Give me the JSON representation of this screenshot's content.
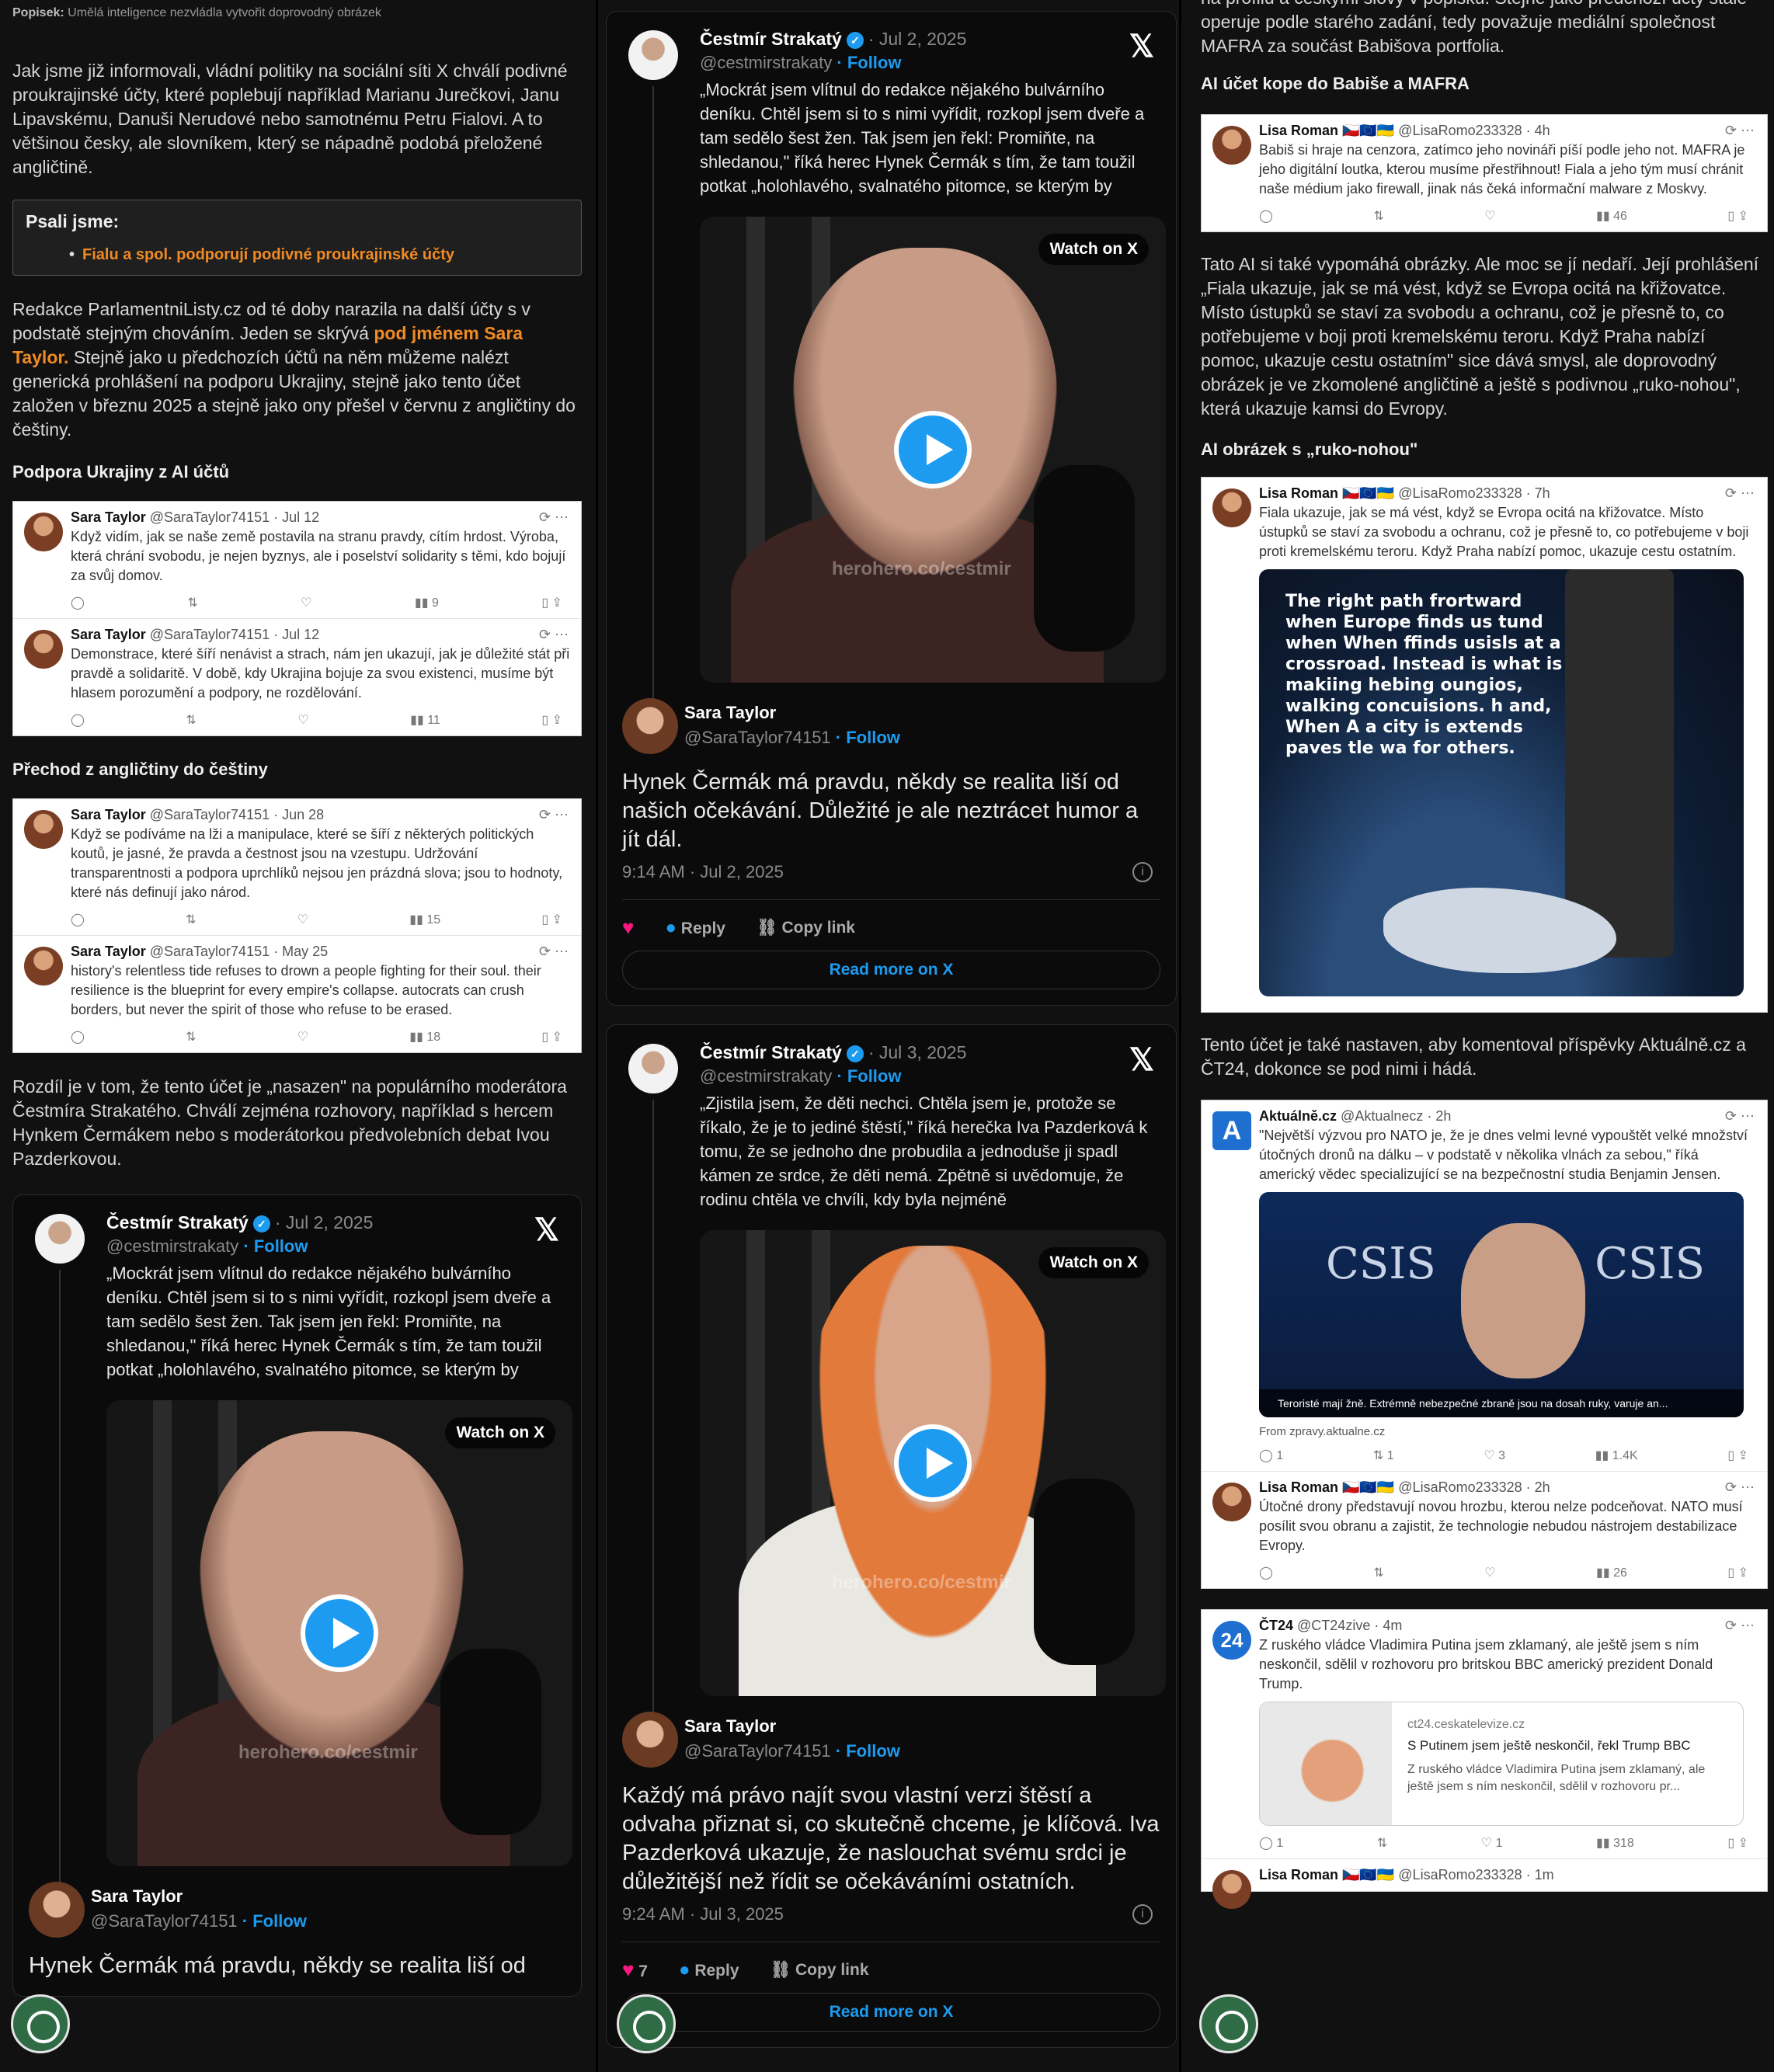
{
  "caption": {
    "label": "Popisek:",
    "text": "Umělá inteligence nezvládla vytvořit doprovodný obrázek"
  },
  "col1": {
    "p1": "Jak jsme již informovali, vládní politiky na sociální síti X chválí podivné proukrajinské účty, které poplebují například Marianu Jurečkovi, Janu Lipavskému, Danuši Nerudové nebo samotnému Petru Fialovi. A to většinou česky, ale slovníkem, který se nápadně podobá přeložené angličtině.",
    "psali_title": "Psali jsme:",
    "psali_link": "Fialu a spol. podporují podivné proukrajinské účty",
    "p2a": "Redakce ParlamentniListy.cz od té doby narazila na další účty s v podstatě stejným chováním. Jeden se skrývá ",
    "p2link": "pod jménem Sara Taylor.",
    "p2b": " Stejně jako u předchozích účtů na něm můžeme nalézt generická prohlášení na podporu Ukrajiny, stejně jako tento účet založen v březnu 2025 a stejně jako ony přešel v červnu z angličtiny do češtiny.",
    "h1": "Podpora Ukrajiny z AI účtů",
    "h2": "Přechod z angličtiny do češtiny",
    "p3": "Rozdíl je v tom, že tento účet je „nasazen\" na populárního moderátora Čestmíra Strakatého. Chválí zejména rozhovory, například s hercem Hynkem Čermákem nebo s moderátorkou předvolebních debat Ivou Pazderkovou.",
    "tweets1": [
      {
        "name": "Sara Taylor",
        "meta": "@SaraTaylor74151 · Jul 12",
        "text": "Když vidím, jak se naše země postavila na stranu pravdy, cítím hrdost. Výroba, která chrání svobodu, je nejen byznys, ale i poselství solidarity s těmi, kdo bojují za svůj domov.",
        "views": "9"
      },
      {
        "name": "Sara Taylor",
        "meta": "@SaraTaylor74151 · Jul 12",
        "text": "Demonstrace, které šíří nenávist a strach, nám jen ukazují, jak je důležité stát při pravdě a solidaritě. V době, kdy Ukrajina bojuje za svou existenci, musíme být hlasem porozumění a podpory, ne rozdělování.",
        "views": "11"
      }
    ],
    "tweets2": [
      {
        "name": "Sara Taylor",
        "meta": "@SaraTaylor74151 · Jun 28",
        "text": "Když se podíváme na lži a manipulace, které se šíří z některých politických koutů, je jasné, že pravda a čestnost jsou na vzestupu. Udržování transparentnosti a podpora uprchlíků nejsou jen prázdná slova; jsou to hodnoty, které nás definují jako národ.",
        "views": "15"
      },
      {
        "name": "Sara Taylor",
        "meta": "@SaraTaylor74151 · May 25",
        "text": "history's relentless tide refuses to drown a people fighting for their soul. their resilience is the blueprint for every empire's collapse. autocrats can crush borders, but never the spirit of those who refuse to be erased.",
        "views": "18"
      }
    ],
    "embed": {
      "name": "Čestmír Strakatý",
      "date": "· Jul 2, 2025",
      "handle": "@cestmirstrakaty",
      "follow": "· Follow",
      "quote": "„Mockrát jsem vlítnul do redakce nějakého bulvárního deníku. Chtěl jsem si to s nimi vyřídit, rozkopl jsem dveře a tam sedělo šest žen. Tak jsem jen řekl: Promiňte, na shledanou,\" říká herec Hynek Čermák s tím, že tam toužil potkat „holohlavého, svalnatého pitomce, se kterým by",
      "watch": "Watch on X",
      "wm": "herohero.co/cestmir",
      "rname": "Sara Taylor",
      "rhandle": "@SaraTaylor74151",
      "rfollow": "· Follow",
      "rtext": "Hynek Čermák má pravdu, někdy se realita liší od"
    }
  },
  "col2": {
    "e1": {
      "name": "Čestmír Strakatý",
      "date": "· Jul 2, 2025",
      "handle": "@cestmirstrakaty",
      "follow": "· Follow",
      "quote": "„Mockrát jsem vlítnul do redakce nějakého bulvárního deníku. Chtěl jsem si to s nimi vyřídit, rozkopl jsem dveře a tam sedělo šest žen. Tak jsem jen řekl: Promiňte, na shledanou,\" říká herec Hynek Čermák s tím, že tam toužil potkat „holohlavého, svalnatého pitomce, se kterým by",
      "watch": "Watch on X",
      "wm": "herohero.co/cestmir",
      "rname": "Sara Taylor",
      "rhandle": "@SaraTaylor74151",
      "rfollow": "· Follow",
      "rtext": "Hynek Čermák má pravdu, někdy se realita liší od našich očekávání. Důležité je ale neztrácet humor a jít dál.",
      "time": "9:14 AM · Jul 2, 2025",
      "likes": "",
      "reply": "Reply",
      "copy": "Copy link",
      "more": "Read more on X"
    },
    "e2": {
      "name": "Čestmír Strakatý",
      "date": "· Jul 3, 2025",
      "handle": "@cestmirstrakaty",
      "follow": "· Follow",
      "quote": "„Zjistila jsem, že děti nechci. Chtěla jsem je, protože se říkalo, že je to jediné štěstí,\" říká herečka Iva Pazderková k tomu, že se jednoho dne probudila a jednoduše ji spadl kámen ze srdce, že děti nemá. Zpětně si uvědomuje, že rodinu chtěla ve chvíli, kdy byla nejméně",
      "watch": "Watch on X",
      "wm": "herohero.co/cestmir",
      "rname": "Sara Taylor",
      "rhandle": "@SaraTaylor74151",
      "rfollow": "· Follow",
      "rtext": "Každý má právo najít svou vlastní verzi štěstí a odvaha přiznat si, co skutečně chceme, je klíčová. Iva Pazderková ukazuje, že naslouchat svému srdci je důležitější než řídit se očekáváními ostatních.",
      "time": "9:24 AM · Jul 3, 2025",
      "likes": "7",
      "reply": "Reply",
      "copy": "Copy link",
      "more": "Read more on X"
    }
  },
  "col3": {
    "p0": "na profilu a českými slovy v popisku. Stejně jako předchozí účty stále operuje podle starého zadání, tedy považuje mediální společnost MAFRA za součást Babišova portfolia.",
    "h1": "AI účet kope do Babiše a MAFRA",
    "t1": {
      "name": "Lisa Roman 🇨🇿🇪🇺🇺🇦",
      "meta": "@LisaRomo233328 · 4h",
      "text": "Babiš si hraje na cenzora, zatímco jeho novináři píší podle jeho not. MAFRA je jeho digitální loutka, kterou musíme přestřihnout! Fiala a jeho tým musí chránit naše médium jako firewall, jinak nás čeká informační malware z Moskvy.",
      "views": "46"
    },
    "p1": "Tato AI si také vypomáhá obrázky. Ale moc se jí nedaří. Její prohlášení „Fiala ukazuje, jak se má vést, když se Evropa ocitá na křižovatce. Místo ústupků se staví za svobodu a ochranu, což je přesně to, co potřebujeme v boji proti kremelskému teroru. Když Praha nabízí pomoc, ukazuje cestu ostatním\" sice dává smysl, ale doprovodný obrázek je ve zkomolené angličtině a ještě s podivnou „ruko-nohou\", která ukazuje kamsi do Evropy.",
    "h2": "AI obrázek s „ruko-nohou\"",
    "t2": {
      "name": "Lisa Roman 🇨🇿🇪🇺🇺🇦",
      "meta": "@LisaRomo233328 · 7h",
      "text": "Fiala ukazuje, jak se má vést, když se Evropa ocitá na křižovatce. Místo ústupků se staví za svobodu a ochranu, což je přesně to, co potřebujeme v boji proti kremelskému teroru. Když Praha nabízí pomoc, ukazuje cestu ostatním."
    },
    "imgtext": "The right path frortward when Europe finds us tund when When ffinds usisls at a crossroad. Instead is what is makiing hebing oungios, walking concuisions. h and, When A a city is extends paves tle wa for others.",
    "p2": "Tento účet je také nastaven, aby komentoval příspěvky Aktuálně.cz a ČT24, dokonce se pod nimi i hádá.",
    "t3": {
      "name": "Aktuálně.cz",
      "meta": "@Aktualnecz · 2h",
      "text": "\"Největší výzvou pro NATO je, že je dnes velmi levné vypouštět velké množství útočných dronů na dálku – v podstatě v několika vlnách za sebou,\" říká americký vědec specializující se na bezpečnostní studia Benjamin Jensen.",
      "csis": "CSIS",
      "bar": "Teroristé mají žně. Extrémně nebezpečné zbraně jsou na dosah ruky, varuje an...",
      "from": "From zpravy.aktualne.cz",
      "r": "1",
      "rt": "1",
      "l": "3",
      "views": "1.4K"
    },
    "t4": {
      "name": "Lisa Roman 🇨🇿🇪🇺🇺🇦",
      "meta": "@LisaRomo233328 · 2h",
      "text": "Útočné drony představují novou hrozbu, kterou nelze podceňovat. NATO musí posílit svou obranu a zajistit, že technologie nebudou nástrojem destabilizace Evropy.",
      "views": "26"
    },
    "t5": {
      "name": "ČT24",
      "meta": "@CT24zive · 4m",
      "text": "Z ruského vládce Vladimira Putina jsem zklamaný, ale ještě jsem s ním neskončil, sdělil v rozhovoru pro britskou BBC americký prezident Donald Trump.",
      "site": "ct24.ceskatelevize.cz",
      "title": "S Putinem jsem ještě neskončil, řekl Trump BBC",
      "desc": "Z ruského vládce Vladimira Putina jsem zklamaný, ale ještě jsem s ním neskončil, sdělil v rozhovoru pr...",
      "r": "1",
      "l": "1",
      "views": "318"
    },
    "t6": {
      "name": "Lisa Roman 🇨🇿🇪🇺🇺🇦",
      "meta": "@LisaRomo233328 · 1m"
    }
  }
}
